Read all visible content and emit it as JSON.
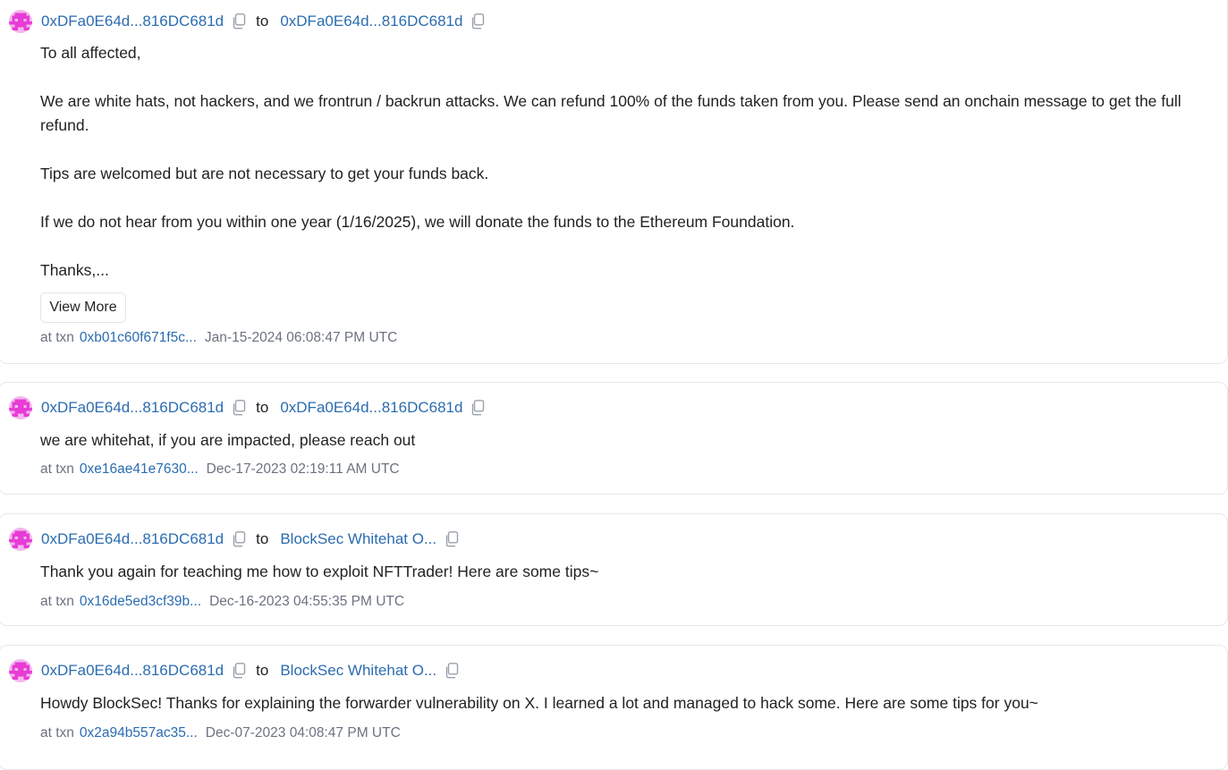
{
  "messages": [
    {
      "from": "0xDFa0E64d...816DC681d",
      "to_word": "to",
      "to": "0xDFa0E64d...816DC681d",
      "text": "To all affected,\n\nWe are white hats, not hackers, and we frontrun / backrun attacks. We can refund 100% of the funds taken from you. Please send an onchain message to get the full refund.\n\nTips are welcomed but are not necessary to get your funds back.\n\nIf we do not hear from you within one year (1/16/2025), we will donate the funds to the Ethereum Foundation.\n\nThanks,...",
      "view_more": "View More",
      "at_txn": "at txn",
      "txn": "0xb01c60f671f5c...",
      "time": "Jan-15-2024 06:08:47 PM UTC"
    },
    {
      "from": "0xDFa0E64d...816DC681d",
      "to_word": "to",
      "to": "0xDFa0E64d...816DC681d",
      "text": "we are whitehat, if you are impacted, please reach out",
      "at_txn": "at txn",
      "txn": "0xe16ae41e7630...",
      "time": "Dec-17-2023 02:19:11 AM UTC"
    },
    {
      "from": "0xDFa0E64d...816DC681d",
      "to_word": "to",
      "to": "BlockSec Whitehat O...",
      "text": "Thank you again for teaching me how to exploit NFTTrader! Here are some tips~",
      "at_txn": "at txn",
      "txn": "0x16de5ed3cf39b...",
      "time": "Dec-16-2023 04:55:35 PM UTC"
    },
    {
      "from": "0xDFa0E64d...816DC681d",
      "to_word": "to",
      "to": "BlockSec Whitehat O...",
      "text": "Howdy BlockSec! Thanks for explaining the forwarder vulnerability on X. I learned a lot and managed to hack some. Here are some tips for you~",
      "at_txn": "at txn",
      "txn": "0x2a94b557ac35...",
      "time": "Dec-07-2023 04:08:47 PM UTC"
    }
  ],
  "colors": {
    "link": "#2b6cb0",
    "text": "#222222",
    "muted": "#6b7280",
    "border": "#e6e8ec",
    "avatar_pink": "#e83bd6"
  },
  "icons": {
    "avatar": "pixel-avatar-icon",
    "copy": "copy-icon"
  }
}
